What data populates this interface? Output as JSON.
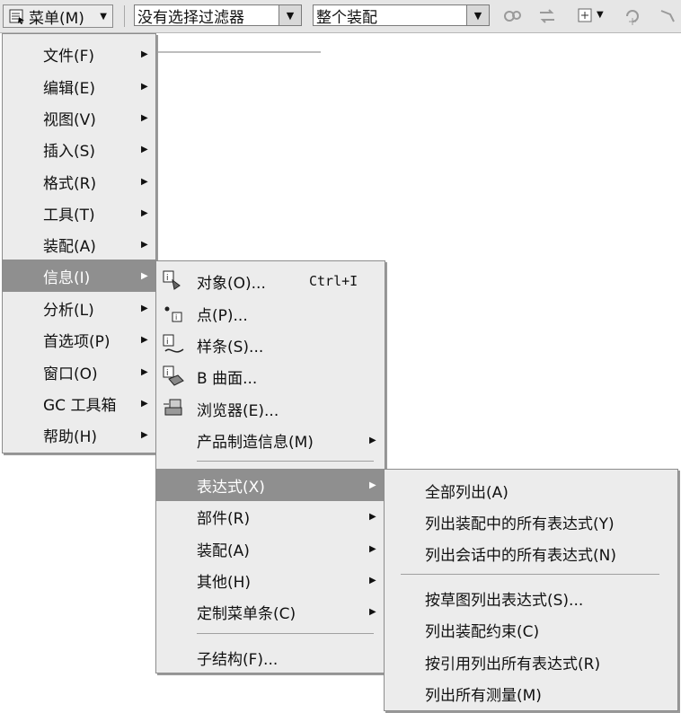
{
  "toolbar": {
    "menu_label": "菜单(M)",
    "filter_value": "没有选择过滤器",
    "scope_value": "整个装配"
  },
  "main_menu": [
    {
      "label": "文件(F)"
    },
    {
      "label": "编辑(E)"
    },
    {
      "label": "视图(V)"
    },
    {
      "label": "插入(S)"
    },
    {
      "label": "格式(R)"
    },
    {
      "label": "工具(T)"
    },
    {
      "label": "装配(A)"
    },
    {
      "label": "信息(I)"
    },
    {
      "label": "分析(L)"
    },
    {
      "label": "首选项(P)"
    },
    {
      "label": "窗口(O)"
    },
    {
      "label": "GC 工具箱"
    },
    {
      "label": "帮助(H)"
    }
  ],
  "info_menu": [
    {
      "label": "对象(O)...",
      "shortcut": "Ctrl+I"
    },
    {
      "label": "点(P)..."
    },
    {
      "label": "样条(S)..."
    },
    {
      "label": "B 曲面..."
    },
    {
      "label": "浏览器(E)..."
    },
    {
      "label": "产品制造信息(M)"
    },
    {
      "label": "表达式(X)"
    },
    {
      "label": "部件(R)"
    },
    {
      "label": "装配(A)"
    },
    {
      "label": "其他(H)"
    },
    {
      "label": "定制菜单条(C)"
    },
    {
      "label": "子结构(F)..."
    }
  ],
  "expr_menu": [
    {
      "label": "全部列出(A)"
    },
    {
      "label": "列出装配中的所有表达式(Y)"
    },
    {
      "label": "列出会话中的所有表达式(N)"
    },
    {
      "label": "按草图列出表达式(S)..."
    },
    {
      "label": "列出装配约束(C)"
    },
    {
      "label": "按引用列出所有表达式(R)"
    },
    {
      "label": "列出所有测量(M)"
    }
  ]
}
